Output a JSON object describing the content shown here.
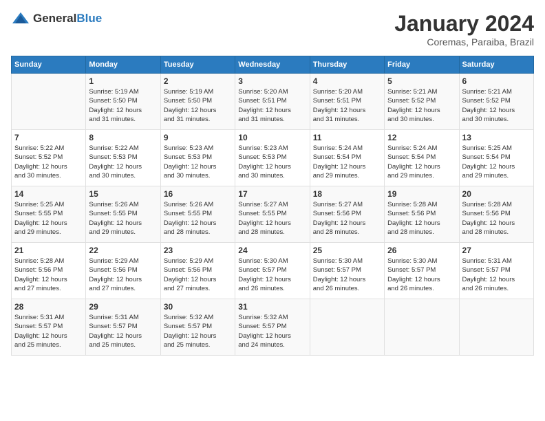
{
  "header": {
    "logo": {
      "general": "General",
      "blue": "Blue"
    },
    "title": "January 2024",
    "location": "Coremas, Paraiba, Brazil"
  },
  "columns": [
    "Sunday",
    "Monday",
    "Tuesday",
    "Wednesday",
    "Thursday",
    "Friday",
    "Saturday"
  ],
  "weeks": [
    [
      {
        "day": "",
        "info": ""
      },
      {
        "day": "1",
        "info": "Sunrise: 5:19 AM\nSunset: 5:50 PM\nDaylight: 12 hours\nand 31 minutes."
      },
      {
        "day": "2",
        "info": "Sunrise: 5:19 AM\nSunset: 5:50 PM\nDaylight: 12 hours\nand 31 minutes."
      },
      {
        "day": "3",
        "info": "Sunrise: 5:20 AM\nSunset: 5:51 PM\nDaylight: 12 hours\nand 31 minutes."
      },
      {
        "day": "4",
        "info": "Sunrise: 5:20 AM\nSunset: 5:51 PM\nDaylight: 12 hours\nand 31 minutes."
      },
      {
        "day": "5",
        "info": "Sunrise: 5:21 AM\nSunset: 5:52 PM\nDaylight: 12 hours\nand 30 minutes."
      },
      {
        "day": "6",
        "info": "Sunrise: 5:21 AM\nSunset: 5:52 PM\nDaylight: 12 hours\nand 30 minutes."
      }
    ],
    [
      {
        "day": "7",
        "info": "Sunrise: 5:22 AM\nSunset: 5:52 PM\nDaylight: 12 hours\nand 30 minutes."
      },
      {
        "day": "8",
        "info": "Sunrise: 5:22 AM\nSunset: 5:53 PM\nDaylight: 12 hours\nand 30 minutes."
      },
      {
        "day": "9",
        "info": "Sunrise: 5:23 AM\nSunset: 5:53 PM\nDaylight: 12 hours\nand 30 minutes."
      },
      {
        "day": "10",
        "info": "Sunrise: 5:23 AM\nSunset: 5:53 PM\nDaylight: 12 hours\nand 30 minutes."
      },
      {
        "day": "11",
        "info": "Sunrise: 5:24 AM\nSunset: 5:54 PM\nDaylight: 12 hours\nand 29 minutes."
      },
      {
        "day": "12",
        "info": "Sunrise: 5:24 AM\nSunset: 5:54 PM\nDaylight: 12 hours\nand 29 minutes."
      },
      {
        "day": "13",
        "info": "Sunrise: 5:25 AM\nSunset: 5:54 PM\nDaylight: 12 hours\nand 29 minutes."
      }
    ],
    [
      {
        "day": "14",
        "info": "Sunrise: 5:25 AM\nSunset: 5:55 PM\nDaylight: 12 hours\nand 29 minutes."
      },
      {
        "day": "15",
        "info": "Sunrise: 5:26 AM\nSunset: 5:55 PM\nDaylight: 12 hours\nand 29 minutes."
      },
      {
        "day": "16",
        "info": "Sunrise: 5:26 AM\nSunset: 5:55 PM\nDaylight: 12 hours\nand 28 minutes."
      },
      {
        "day": "17",
        "info": "Sunrise: 5:27 AM\nSunset: 5:55 PM\nDaylight: 12 hours\nand 28 minutes."
      },
      {
        "day": "18",
        "info": "Sunrise: 5:27 AM\nSunset: 5:56 PM\nDaylight: 12 hours\nand 28 minutes."
      },
      {
        "day": "19",
        "info": "Sunrise: 5:28 AM\nSunset: 5:56 PM\nDaylight: 12 hours\nand 28 minutes."
      },
      {
        "day": "20",
        "info": "Sunrise: 5:28 AM\nSunset: 5:56 PM\nDaylight: 12 hours\nand 28 minutes."
      }
    ],
    [
      {
        "day": "21",
        "info": "Sunrise: 5:28 AM\nSunset: 5:56 PM\nDaylight: 12 hours\nand 27 minutes."
      },
      {
        "day": "22",
        "info": "Sunrise: 5:29 AM\nSunset: 5:56 PM\nDaylight: 12 hours\nand 27 minutes."
      },
      {
        "day": "23",
        "info": "Sunrise: 5:29 AM\nSunset: 5:56 PM\nDaylight: 12 hours\nand 27 minutes."
      },
      {
        "day": "24",
        "info": "Sunrise: 5:30 AM\nSunset: 5:57 PM\nDaylight: 12 hours\nand 26 minutes."
      },
      {
        "day": "25",
        "info": "Sunrise: 5:30 AM\nSunset: 5:57 PM\nDaylight: 12 hours\nand 26 minutes."
      },
      {
        "day": "26",
        "info": "Sunrise: 5:30 AM\nSunset: 5:57 PM\nDaylight: 12 hours\nand 26 minutes."
      },
      {
        "day": "27",
        "info": "Sunrise: 5:31 AM\nSunset: 5:57 PM\nDaylight: 12 hours\nand 26 minutes."
      }
    ],
    [
      {
        "day": "28",
        "info": "Sunrise: 5:31 AM\nSunset: 5:57 PM\nDaylight: 12 hours\nand 25 minutes."
      },
      {
        "day": "29",
        "info": "Sunrise: 5:31 AM\nSunset: 5:57 PM\nDaylight: 12 hours\nand 25 minutes."
      },
      {
        "day": "30",
        "info": "Sunrise: 5:32 AM\nSunset: 5:57 PM\nDaylight: 12 hours\nand 25 minutes."
      },
      {
        "day": "31",
        "info": "Sunrise: 5:32 AM\nSunset: 5:57 PM\nDaylight: 12 hours\nand 24 minutes."
      },
      {
        "day": "",
        "info": ""
      },
      {
        "day": "",
        "info": ""
      },
      {
        "day": "",
        "info": ""
      }
    ]
  ]
}
